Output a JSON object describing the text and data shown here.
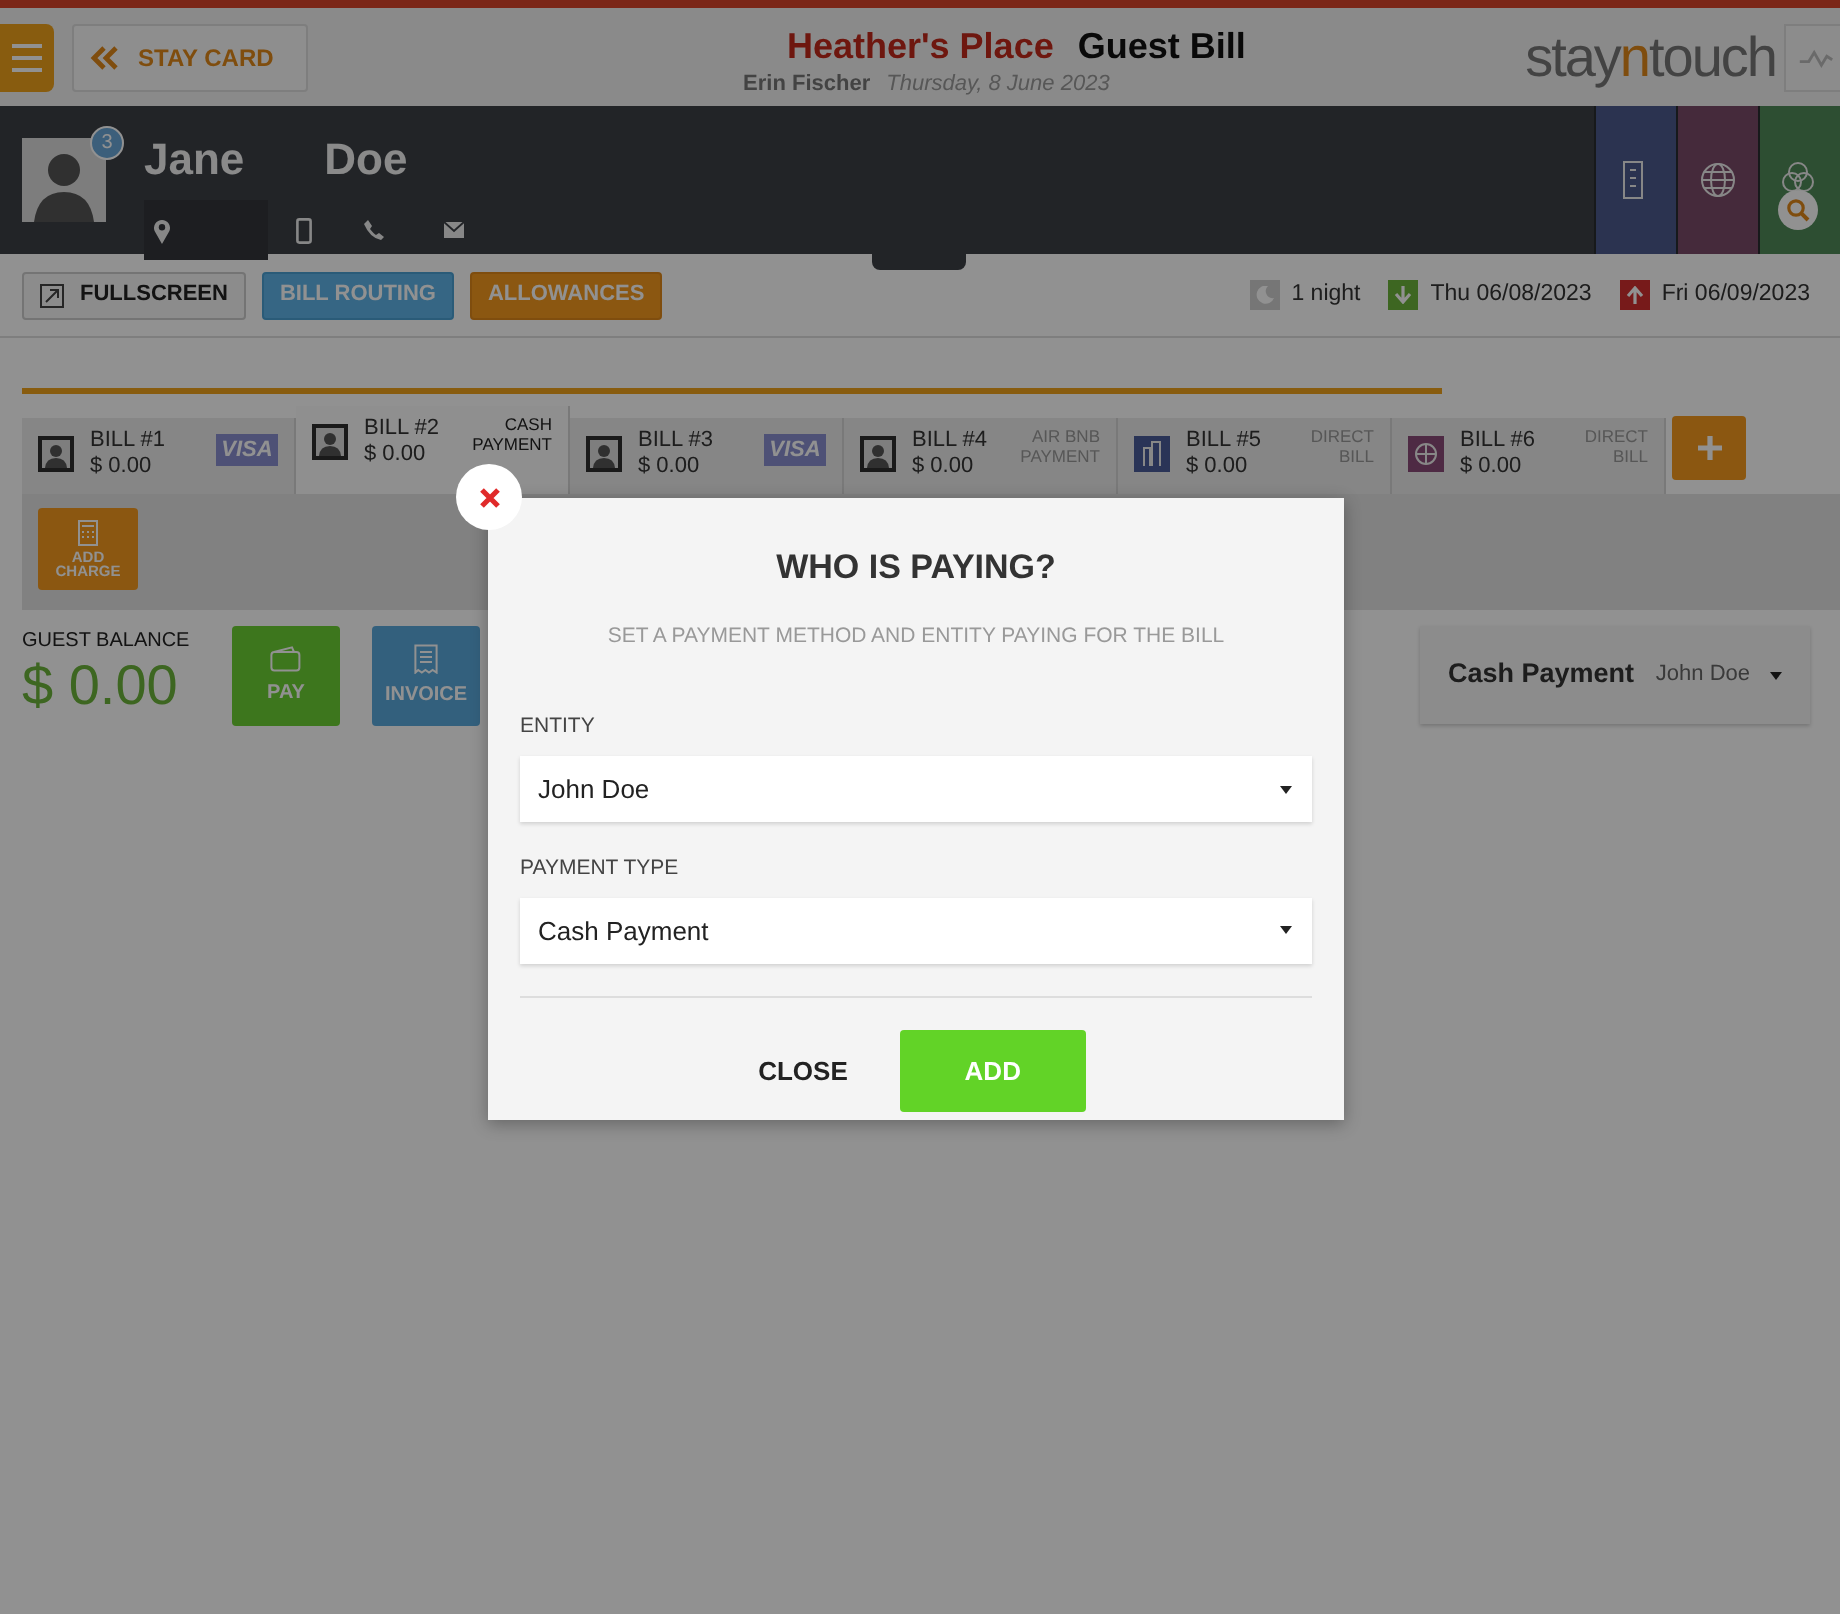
{
  "top_bar": {
    "back_button": "STAY CARD",
    "hotel": "Heather's Place",
    "title": "Guest Bill",
    "user": "Erin Fischer",
    "date": "Thursday, 8 June 2023",
    "logo_parts": [
      {
        "text": "stay",
        "accent": false
      },
      {
        "text": "n",
        "accent": true
      },
      {
        "text": "touch",
        "accent": false
      }
    ]
  },
  "guest": {
    "first_name": "Jane",
    "last_name": "Doe",
    "badge": "3"
  },
  "toolbar": {
    "buttons": [
      {
        "label": "FULLSCREEN",
        "kind": "plain"
      },
      {
        "label": "BILL ROUTING",
        "kind": "info"
      },
      {
        "label": "ALLOWANCES",
        "kind": "warning"
      }
    ],
    "nights": "1 night",
    "arrival": "Thu 06/08/2023",
    "departure": "Fri 06/09/2023"
  },
  "bills": [
    {
      "label": "BILL #1",
      "amount": "$ 0.00",
      "kind": "card",
      "payment": "VISA",
      "selected": false
    },
    {
      "label": "BILL #2",
      "amount": "$ 0.00",
      "kind": "cash",
      "payment": "CASH PAYMENT",
      "selected": true
    },
    {
      "label": "BILL #3",
      "amount": "$ 0.00",
      "kind": "card",
      "payment": "VISA",
      "selected": false
    },
    {
      "label": "BILL #4",
      "amount": "$ 0.00",
      "kind": "other",
      "payment": "AIR BNB PAYMENT",
      "selected": false
    },
    {
      "label": "BILL #5",
      "amount": "$ 0.00",
      "kind": "company",
      "payment": "DIRECT BILL",
      "selected": false
    },
    {
      "label": "BILL #6",
      "amount": "$ 0.00",
      "kind": "agent",
      "payment": "DIRECT BILL",
      "selected": false
    }
  ],
  "add_charge": "ADD CHARGE",
  "guest_balance": {
    "label": "GUEST BALANCE",
    "amount": "$ 0.00"
  },
  "actions": [
    {
      "label": "PAY",
      "kind": "pay"
    },
    {
      "label": "INVOICE",
      "kind": "invoice"
    }
  ],
  "payment_summary": {
    "type": "Cash Payment",
    "entity": "John Doe"
  },
  "modal": {
    "title": "WHO IS PAYING?",
    "subtitle": "SET A PAYMENT METHOD AND ENTITY PAYING FOR THE BILL",
    "fields": [
      {
        "label": "ENTITY",
        "value": "John Doe"
      },
      {
        "label": "PAYMENT TYPE",
        "value": "Cash Payment"
      }
    ],
    "close": "CLOSE",
    "add": "ADD"
  }
}
